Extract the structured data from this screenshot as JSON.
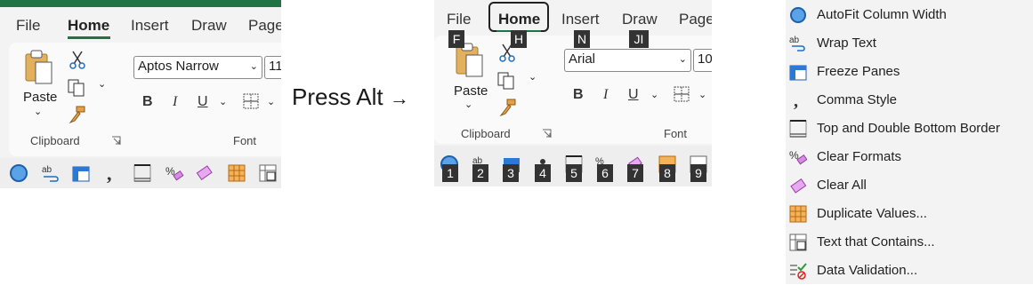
{
  "left_ribbon": {
    "tabs": [
      "File",
      "Home",
      "Insert",
      "Draw",
      "Page"
    ],
    "paste_label": "Paste",
    "font_name": "Aptos Narrow",
    "font_size": "11",
    "bold": "B",
    "italic": "I",
    "underline": "U",
    "clipboard_label": "Clipboard",
    "font_label": "Font"
  },
  "middle": {
    "text": "Press Alt",
    "arrow": "→"
  },
  "right_ribbon": {
    "tabs": [
      "File",
      "Home",
      "Insert",
      "Draw",
      "Page"
    ],
    "tab_keytips": [
      "F",
      "H",
      "N",
      "JI"
    ],
    "paste_label": "Paste",
    "font_name": "Arial",
    "font_size": "10",
    "bold": "B",
    "italic": "I",
    "underline": "U",
    "clipboard_label": "Clipboard",
    "font_label": "Font",
    "qat_keytips": [
      "1",
      "2",
      "3",
      "4",
      "5",
      "6",
      "7",
      "8",
      "9"
    ]
  },
  "menu": {
    "items": [
      {
        "label": "AutoFit Column Width",
        "icon": "autofit-icon"
      },
      {
        "label": "Wrap Text",
        "icon": "wrap-text-icon"
      },
      {
        "label": "Freeze Panes",
        "icon": "freeze-panes-icon"
      },
      {
        "label": "Comma Style",
        "icon": "comma-style-icon"
      },
      {
        "label": "Top and Double Bottom Border",
        "icon": "border-icon"
      },
      {
        "label": "Clear Formats",
        "icon": "clear-formats-icon"
      },
      {
        "label": "Clear All",
        "icon": "clear-all-icon"
      },
      {
        "label": "Duplicate Values...",
        "icon": "duplicate-values-icon"
      },
      {
        "label": "Text that Contains...",
        "icon": "text-contains-icon"
      },
      {
        "label": "Data Validation...",
        "icon": "data-validation-icon"
      }
    ]
  },
  "colors": {
    "accent_green": "#217346",
    "panel_bg": "#f3f3f3",
    "keytip_bg": "#333333"
  }
}
